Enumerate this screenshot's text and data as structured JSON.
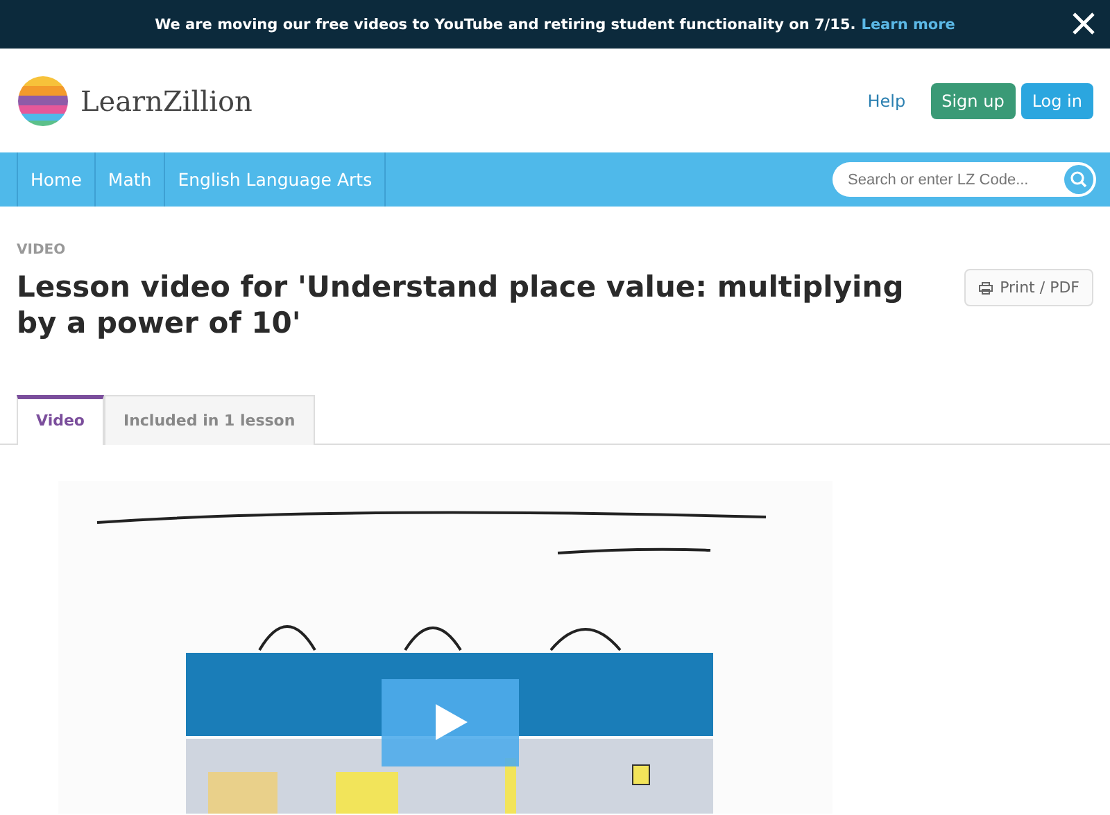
{
  "banner": {
    "message": "We are moving our free videos to YouTube and retiring student functionality on 7/15.",
    "link": "Learn more"
  },
  "header": {
    "logo_text": "LearnZillion",
    "help": "Help",
    "signup": "Sign up",
    "login": "Log in"
  },
  "nav": {
    "items": [
      {
        "label": "Home"
      },
      {
        "label": "Math"
      },
      {
        "label": "English Language Arts"
      }
    ],
    "search": {
      "placeholder": "Search or enter LZ Code..."
    }
  },
  "page": {
    "eyebrow": "VIDEO",
    "title": "Lesson video for 'Understand place value: multiplying by a power of 10'",
    "print": "Print / PDF"
  },
  "tabs": [
    {
      "label": "Video",
      "selected": true
    },
    {
      "label": "Included in 1 lesson",
      "selected": false
    }
  ]
}
